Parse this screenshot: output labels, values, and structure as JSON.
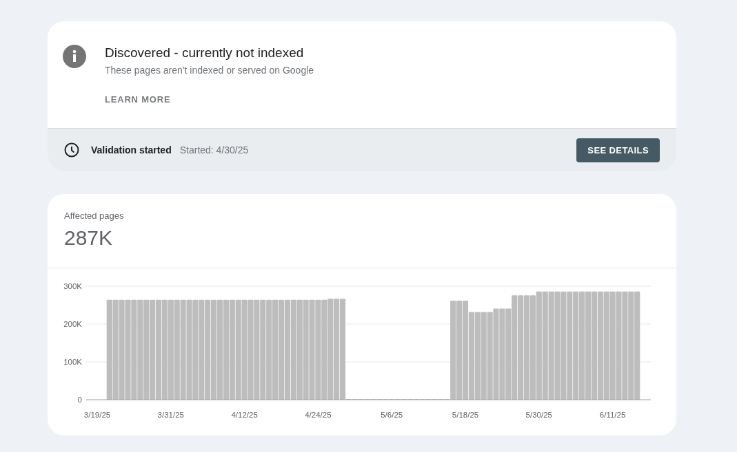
{
  "issue": {
    "title": "Discovered - currently not indexed",
    "description": "These pages aren't indexed or served on Google",
    "learn_more": "LEARN MORE",
    "validation_status": "Validation started",
    "validation_date": "Started: 4/30/25",
    "details_button": "SEE DETAILS"
  },
  "summary": {
    "label": "Affected pages",
    "value": "287K",
    "chart_data": {
      "type": "bar",
      "categories": [
        "3/19/25",
        null,
        null,
        null,
        null,
        null,
        null,
        null,
        null,
        null,
        null,
        null,
        "3/31/25",
        null,
        null,
        null,
        null,
        null,
        null,
        null,
        null,
        null,
        null,
        null,
        "4/12/25",
        null,
        null,
        null,
        null,
        null,
        null,
        null,
        null,
        null,
        null,
        null,
        "4/24/25",
        null,
        null,
        null,
        null,
        null,
        null,
        null,
        null,
        null,
        null,
        null,
        "5/6/25",
        null,
        null,
        null,
        null,
        null,
        null,
        null,
        null,
        null,
        null,
        null,
        "5/18/25",
        null,
        null,
        null,
        null,
        null,
        null,
        null,
        null,
        null,
        null,
        null,
        "5/30/25",
        null,
        null,
        null,
        null,
        null,
        null,
        null,
        null,
        null,
        null,
        null,
        "6/11/25",
        null,
        null,
        null,
        null
      ],
      "series": [
        {
          "color": "#bdbdbd",
          "values": [
            null,
            null,
            264000,
            264000,
            264000,
            264000,
            264000,
            264000,
            264000,
            264000,
            264000,
            264000,
            264000,
            264000,
            264000,
            264000,
            264000,
            264000,
            264000,
            264000,
            264000,
            264000,
            264000,
            264000,
            264000,
            264000,
            264000,
            264000,
            264000,
            264000,
            264000,
            264000,
            264000,
            264000,
            264000,
            264000,
            264000,
            264000,
            267000,
            267000,
            267000,
            0,
            0,
            0,
            0,
            0,
            0,
            0,
            0,
            0,
            0,
            0,
            0,
            0,
            0,
            0,
            0,
            0,
            262000,
            262000,
            262000,
            232000,
            232000,
            232000,
            232000,
            241000,
            241000,
            241000,
            276000,
            276000,
            276000,
            276000,
            286000,
            286000,
            286000,
            286000,
            286000,
            286000,
            286000,
            286000,
            286000,
            286000,
            286000,
            286000,
            286000,
            286000,
            286000,
            286000,
            286000
          ]
        }
      ],
      "ylim": [
        0,
        300000
      ],
      "yticks": [
        {
          "value": 0,
          "label": "0"
        },
        {
          "value": 100000,
          "label": "100K"
        },
        {
          "value": 200000,
          "label": "200K"
        },
        {
          "value": 300000,
          "label": "300K"
        }
      ]
    }
  }
}
